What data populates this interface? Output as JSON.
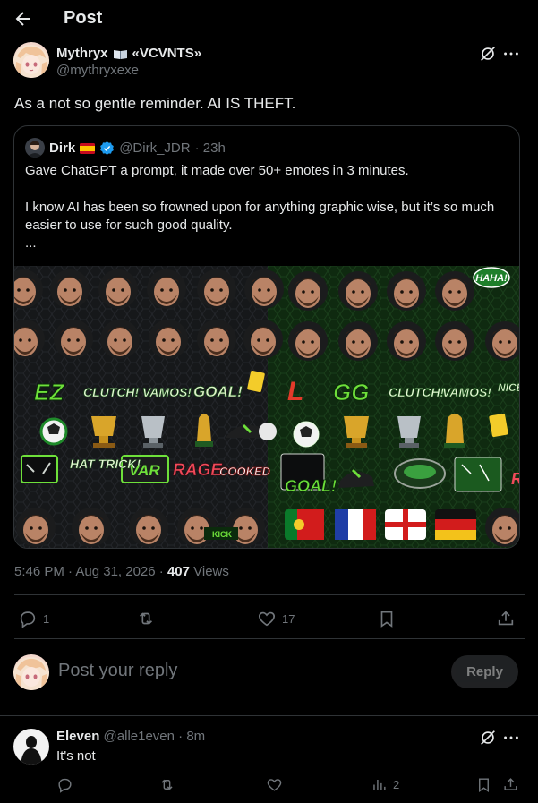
{
  "header": {
    "title": "Post"
  },
  "post": {
    "author_name": "Mythryx",
    "author_suffix": "«VCVNTS»",
    "author_handle": "@mythryxexe",
    "text": "As a not so gentle reminder. AI IS THEFT.",
    "timestamp": "5:46 PM · Aug 31, 2026 · ",
    "views_count": "407",
    "views_label": " Views",
    "stats": {
      "replies": "1",
      "reposts": "",
      "likes": "17"
    }
  },
  "quote": {
    "author_name": "Dirk",
    "author_handle": "@Dirk_JDR",
    "time": "· 23h",
    "line1": "Gave ChatGPT a prompt, it made over 50+ emotes in 3 minutes.",
    "line2": "I know AI has been so frowned upon for anything graphic wise, but it’s so much easier to use for such good quality.",
    "line3": "...",
    "media": {
      "left_labels": [
        "EZ",
        "CLUTCH!",
        "VAMOS!",
        "GOAL!",
        "HAT TRICK!",
        "VAR",
        "RAGE",
        "COOKED",
        "KICK"
      ],
      "right_labels": [
        "HAHA!",
        "GG",
        "CLUTCH!",
        "VAMOS!",
        "NICE GOAL",
        "GOAL!",
        "RAGE"
      ]
    }
  },
  "reply_box": {
    "placeholder": "Post your reply",
    "button": "Reply"
  },
  "reply": {
    "author_name": "Eleven",
    "author_handle": "@alle1even",
    "time": "· 8m",
    "text": "It's not",
    "stats": {
      "views": "2"
    }
  },
  "colors": {
    "background": "#000000",
    "text": "#e7e9ea",
    "muted": "#71767b",
    "border": "#2f3336",
    "verified": "#1d9bf0"
  }
}
